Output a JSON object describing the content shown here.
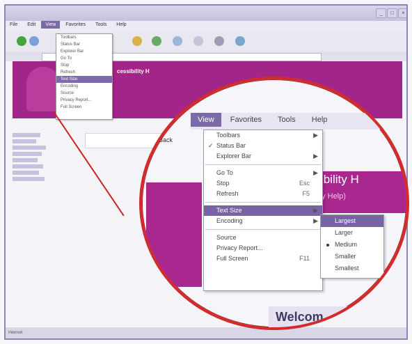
{
  "background_window": {
    "menubar": [
      "File",
      "Edit",
      "View",
      "Favorites",
      "Tools",
      "Help"
    ],
    "view_menu_small": [
      "Toolbars",
      "Status Bar",
      "Explorer Bar",
      "Go To",
      "Stop",
      "Refresh",
      "Text Size",
      "Encoding",
      "Source",
      "Privacy Report...",
      "Full Screen"
    ],
    "status": "Internet"
  },
  "magnified": {
    "menubar": {
      "view": "View",
      "favorites": "Favorites",
      "tools": "Tools",
      "help": "Help"
    },
    "view_menu": [
      {
        "label": "Toolbars",
        "arrow": true
      },
      {
        "label": "Status Bar",
        "check": true
      },
      {
        "label": "Explorer Bar",
        "arrow": true
      },
      {
        "sep": true
      },
      {
        "label": "Go To",
        "arrow": true
      },
      {
        "label": "Stop",
        "key": "Esc"
      },
      {
        "label": "Refresh",
        "key": "F5"
      },
      {
        "sep": true
      },
      {
        "label": "Text Size",
        "arrow": true,
        "highlight": true
      },
      {
        "label": "Encoding",
        "arrow": true
      },
      {
        "sep": true
      },
      {
        "label": "Source"
      },
      {
        "label": "Privacy Report..."
      },
      {
        "label": "Full Screen",
        "key": "F11"
      }
    ],
    "text_size_menu": [
      {
        "label": "Largest",
        "highlight": true
      },
      {
        "label": "Larger"
      },
      {
        "label": "Medium",
        "selected": true
      },
      {
        "label": "Smaller"
      },
      {
        "label": "Smallest"
      }
    ],
    "banner_title": "cessibility H",
    "banner_subtitle": "essibility Help)",
    "back_label": "Back",
    "welcome": "Welcom"
  },
  "colors": {
    "accent": "#7863a4",
    "banner": "#a8288f",
    "circle": "#d12b2b"
  }
}
